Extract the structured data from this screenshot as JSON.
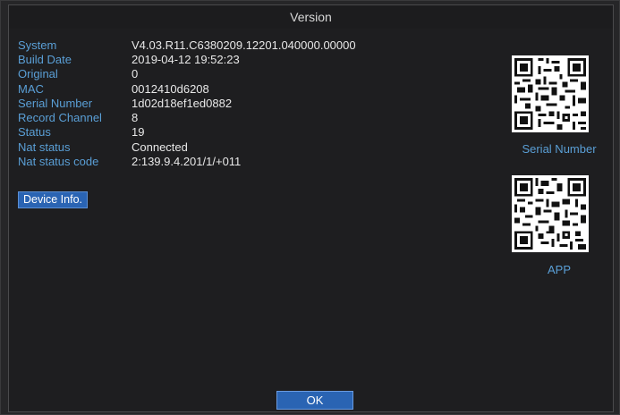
{
  "window": {
    "title": "Version"
  },
  "info": [
    {
      "label": "System",
      "value": "V4.03.R11.C6380209.12201.040000.00000"
    },
    {
      "label": "Build Date",
      "value": "2019-04-12 19:52:23"
    },
    {
      "label": "Original",
      "value": "0"
    },
    {
      "label": "MAC",
      "value": "0012410d6208"
    },
    {
      "label": "Serial Number",
      "value": "1d02d18ef1ed0882"
    },
    {
      "label": "Record Channel",
      "value": "8"
    },
    {
      "label": "Status",
      "value": "19"
    },
    {
      "label": "Nat status",
      "value": "Connected"
    },
    {
      "label": "Nat status code",
      "value": "2:139.9.4.201/1/+011"
    }
  ],
  "buttons": {
    "device_info": "Device Info.",
    "ok": "OK"
  },
  "qr": {
    "serial_label": "Serial Number",
    "app_label": "APP"
  },
  "colors": {
    "label": "#5a9fd6",
    "value": "#e8e8e8",
    "button": "#2a64b3",
    "background": "#1e1e20"
  }
}
